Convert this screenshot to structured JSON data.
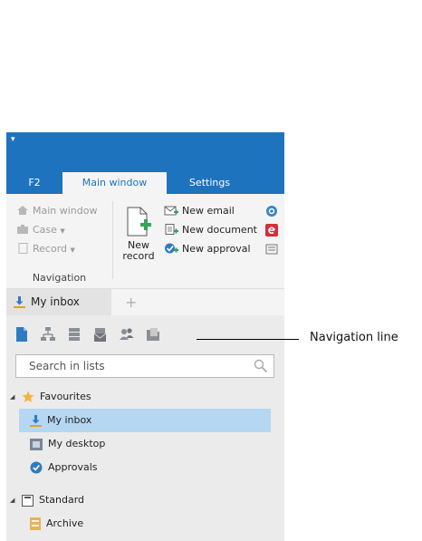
{
  "ribbon_tabs": [
    "F2",
    "Main window",
    "Settings"
  ],
  "ribbon": {
    "nav_items": [
      "Main window",
      "Case",
      "Record"
    ],
    "nav_group_label": "Navigation",
    "new_record_line1": "New",
    "new_record_line2": "record",
    "new_items": [
      "New email",
      "New document",
      "New approval"
    ]
  },
  "doc_tab": "My inbox",
  "add_tab_symbol": "+",
  "search": {
    "placeholder": "Search in lists",
    "value": ""
  },
  "tree": {
    "favourites": "Favourites",
    "fav_items": [
      "My inbox",
      "My desktop",
      "Approvals"
    ],
    "standard": "Standard",
    "std_items": [
      "Archive"
    ]
  },
  "callout": "Navigation line",
  "colors": {
    "brand_blue": "#1e73be",
    "selected_row": "#b5d7f2",
    "panel_bg": "#ebebeb",
    "ribbon_bg": "#f4f4f4"
  }
}
